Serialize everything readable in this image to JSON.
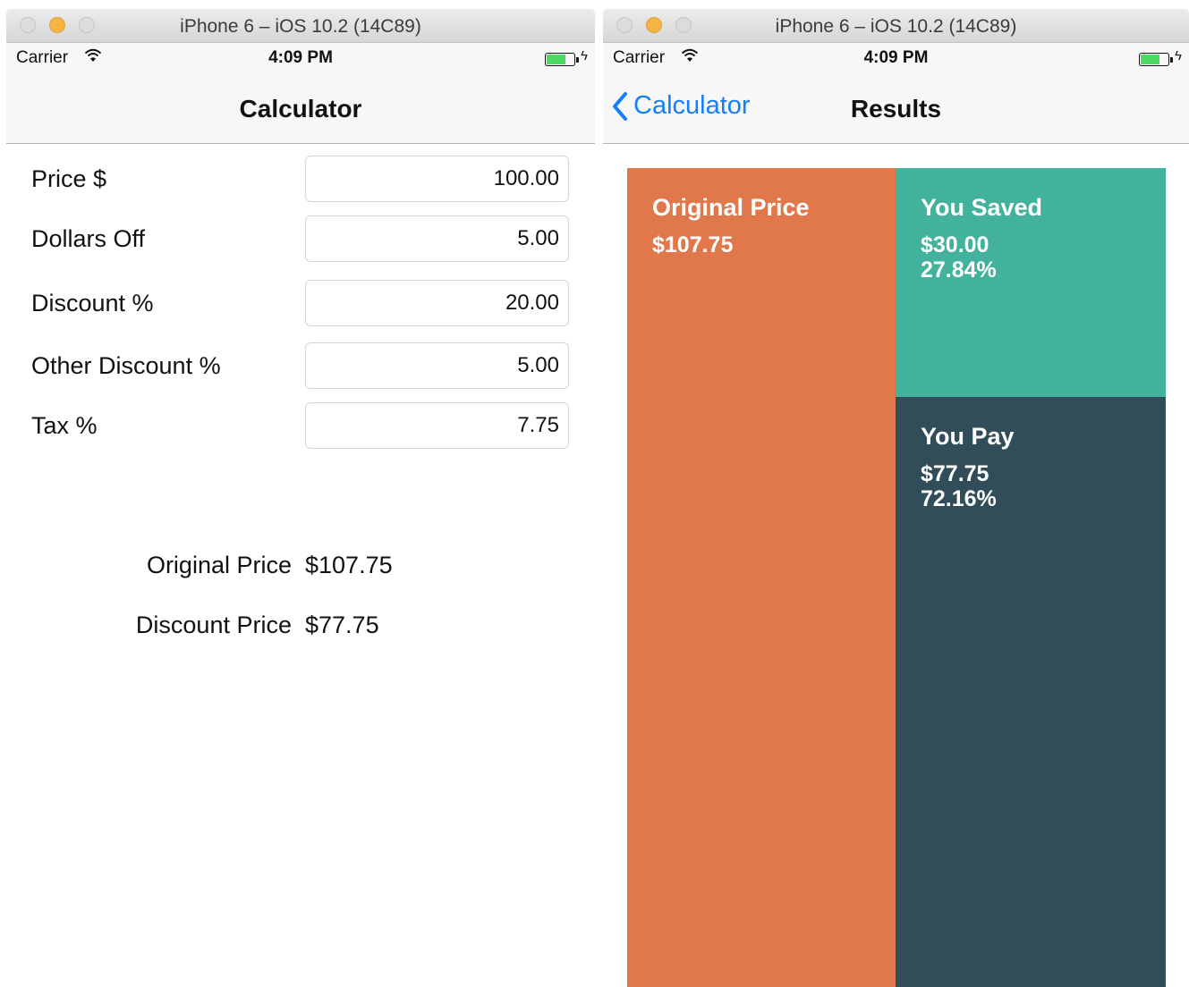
{
  "simulator": {
    "window_title": "iPhone 6 – iOS 10.2 (14C89)",
    "status": {
      "carrier": "Carrier",
      "time": "4:09 PM"
    }
  },
  "calculator_screen": {
    "nav_title": "Calculator",
    "fields": [
      {
        "label": "Price $",
        "value": "100.00"
      },
      {
        "label": "Dollars Off",
        "value": "5.00"
      },
      {
        "label": "Discount %",
        "value": "20.00"
      },
      {
        "label": "Other Discount %",
        "value": "5.00"
      },
      {
        "label": "Tax %",
        "value": "7.75"
      }
    ],
    "results": [
      {
        "label": "Original Price",
        "value": "$107.75"
      },
      {
        "label": "Discount Price",
        "value": "$77.75"
      }
    ]
  },
  "results_screen": {
    "back_label": "Calculator",
    "nav_title": "Results",
    "tiles": {
      "original": {
        "title": "Original Price",
        "amount": "$107.75",
        "color": "#e1784b"
      },
      "saved": {
        "title": "You Saved",
        "amount": "$30.00",
        "percent": "27.84%",
        "color": "#43b29c"
      },
      "pay": {
        "title": "You Pay",
        "amount": "$77.75",
        "percent": "72.16%",
        "color": "#314d59"
      }
    }
  },
  "colors": {
    "accent": "#147efb",
    "battery": "#4cd964"
  }
}
